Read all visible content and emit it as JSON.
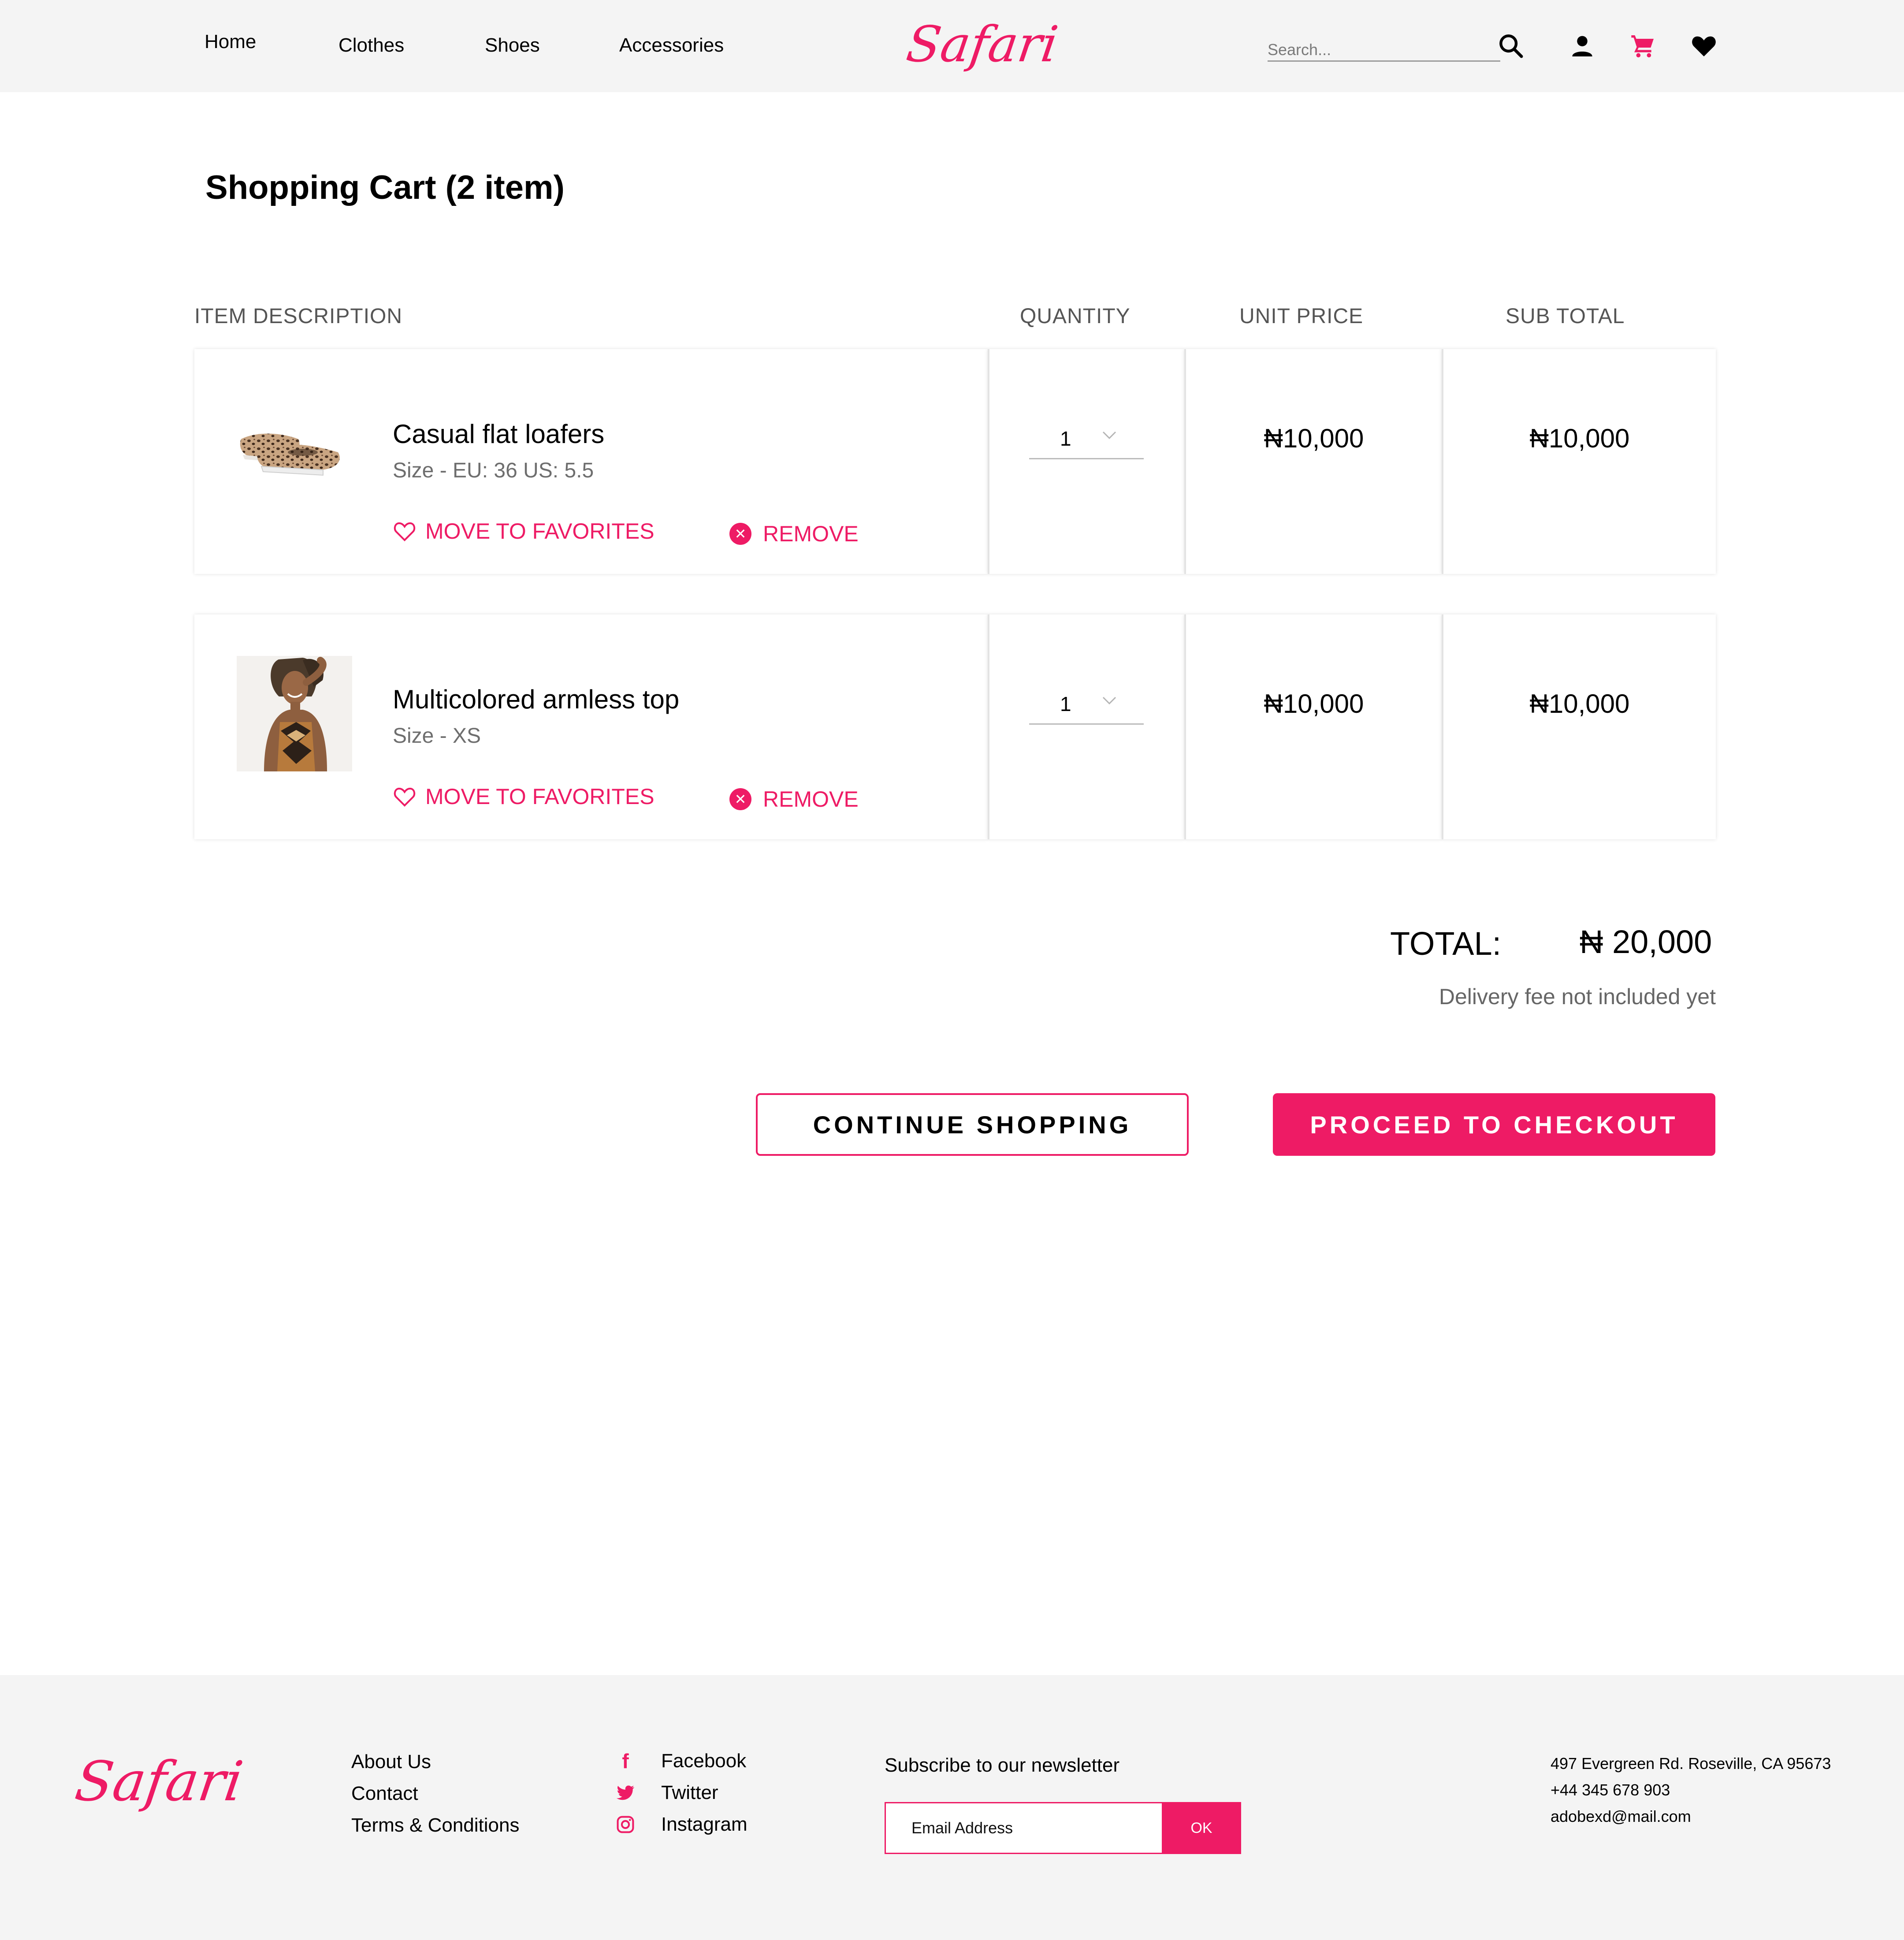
{
  "header": {
    "nav": [
      "Home",
      "Clothes",
      "Shoes",
      "Accessories"
    ],
    "logo": "Safari",
    "search_placeholder": "Search...",
    "icons": [
      "search-icon",
      "user-icon",
      "cart-icon",
      "heart-icon"
    ]
  },
  "page": {
    "title": "Shopping Cart (2 item)"
  },
  "table": {
    "columns": [
      "ITEM DESCRIPTION",
      "QUANTITY",
      "UNIT PRICE",
      "SUB TOTAL"
    ],
    "items": [
      {
        "name": "Casual flat loafers",
        "size": "Size - EU: 36 US: 5.5",
        "quantity": "1",
        "unit_price": "₦10,000",
        "sub_total": "₦10,000",
        "fav_label": "MOVE TO FAVORITES",
        "remove_label": "REMOVE"
      },
      {
        "name": "Multicolored armless top",
        "size": "Size - XS",
        "quantity": "1",
        "unit_price": "₦10,000",
        "sub_total": "₦10,000",
        "fav_label": "MOVE TO FAVORITES",
        "remove_label": "REMOVE"
      }
    ]
  },
  "summary": {
    "total_label": "TOTAL:",
    "total_value": "₦ 20,000",
    "delivery_note": "Delivery fee not included yet",
    "continue_label": "CONTINUE SHOPPING",
    "checkout_label": "PROCEED TO CHECKOUT"
  },
  "footer": {
    "logo": "Safari",
    "links": [
      "About Us",
      "Contact",
      "Terms & Conditions"
    ],
    "social": [
      "Facebook",
      "Twitter",
      "Instagram"
    ],
    "newsletter_title": "Subscribe to our newsletter",
    "email_placeholder": "Email Address",
    "ok_label": "OK",
    "contact": [
      "497 Evergreen Rd. Roseville, CA 95673",
      "+44 345 678 903",
      "adobexd@mail.com"
    ]
  },
  "colors": {
    "accent": "#ee1b65",
    "header_bg": "#f4f4f4",
    "footer_bg": "#f4f4f4"
  }
}
